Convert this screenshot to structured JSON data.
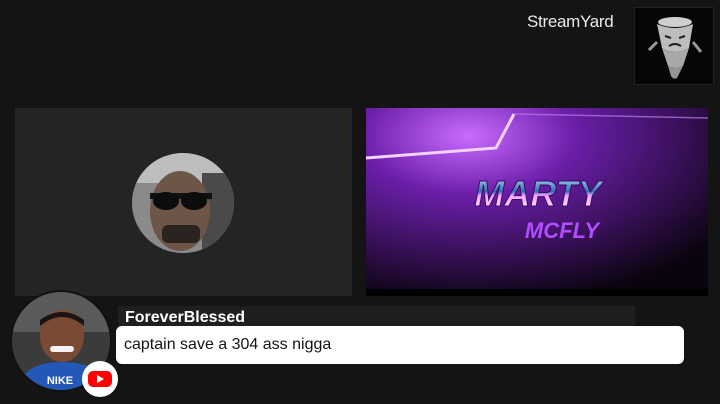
{
  "header": {
    "brand": "StreamYard",
    "logo_icon": "tornado-character-icon"
  },
  "participants": [
    {
      "icon": "participant-avatar-icon",
      "kind": "avatar"
    },
    {
      "icon": "marty-mcfly-logo",
      "kind": "screen-share",
      "logo_text": [
        "MARTY",
        "MCFLY"
      ]
    }
  ],
  "comment": {
    "author": "ForeverBlessed",
    "text": "captain save a 304 ass nigga",
    "platform_icon": "youtube-icon"
  },
  "colors": {
    "background": "#141414",
    "tile": "#242424",
    "purple_accent": "#a03cff",
    "youtube_red": "#ff0000"
  }
}
